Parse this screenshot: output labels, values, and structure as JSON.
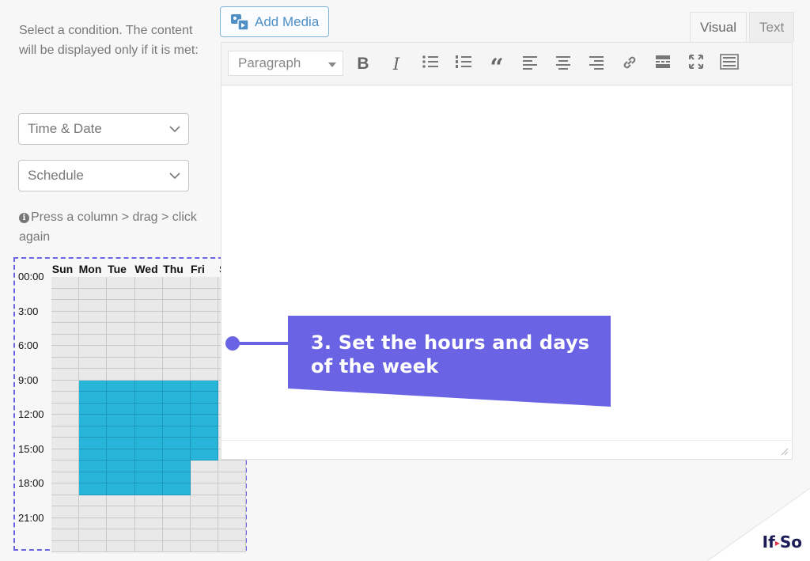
{
  "condition": {
    "description": "Select a condition. The content will be displayed only if it is met:",
    "type_select": "Time & Date",
    "subtype_select": "Schedule",
    "hint": "Press a column > drag > click again"
  },
  "schedule": {
    "days": [
      "Sun",
      "Mon",
      "Tue",
      "Wed",
      "Thu",
      "Fri",
      "Sat"
    ],
    "hour_labels": [
      "00:00",
      "3:00",
      "6:00",
      "9:00",
      "12:00",
      "15:00",
      "18:00",
      "21:00"
    ],
    "selected_color": "#27b5d9",
    "selected_ranges": [
      {
        "day": "Mon",
        "from": "09:00",
        "to": "19:00"
      },
      {
        "day": "Tue",
        "from": "09:00",
        "to": "19:00"
      },
      {
        "day": "Wed",
        "from": "09:00",
        "to": "19:00"
      },
      {
        "day": "Thu",
        "from": "09:00",
        "to": "19:00"
      },
      {
        "day": "Fri",
        "from": "09:00",
        "to": "16:00"
      }
    ]
  },
  "editor": {
    "add_media_label": "Add Media",
    "tabs": [
      {
        "label": "Visual",
        "active": true
      },
      {
        "label": "Text",
        "active": false
      }
    ],
    "format_select": "Paragraph",
    "toolbar_icons": [
      "bold-icon",
      "italic-icon",
      "bullet-list-icon",
      "numbered-list-icon",
      "blockquote-icon",
      "align-left-icon",
      "align-center-icon",
      "align-right-icon",
      "link-icon",
      "read-more-icon",
      "fullscreen-icon",
      "toolbar-toggle-icon"
    ],
    "bold_glyph": "B",
    "italic_glyph": "I",
    "quote_glyph": "“"
  },
  "callout": {
    "text": "3. Set the hours and days of the week",
    "color": "#6a63e4"
  },
  "brand": {
    "logo_left": "If",
    "logo_right": "So"
  }
}
